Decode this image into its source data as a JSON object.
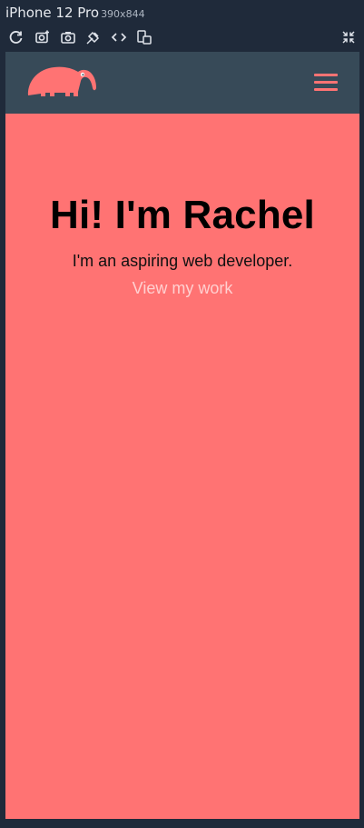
{
  "device": {
    "name": "iPhone 12 Pro",
    "dimensions": "390x844"
  },
  "toolbar": {
    "icons": [
      "rotate-icon",
      "camera-settings-icon",
      "screenshot-icon",
      "touch-toggle-icon",
      "source-code-icon",
      "responsive-icon",
      "collapse-icon"
    ]
  },
  "site": {
    "accent": "#ff7373",
    "header_bg": "#374a58",
    "hero": {
      "title": "Hi! I'm Rachel",
      "subtitle": "I'm an aspiring web developer.",
      "link": "View my work"
    }
  }
}
